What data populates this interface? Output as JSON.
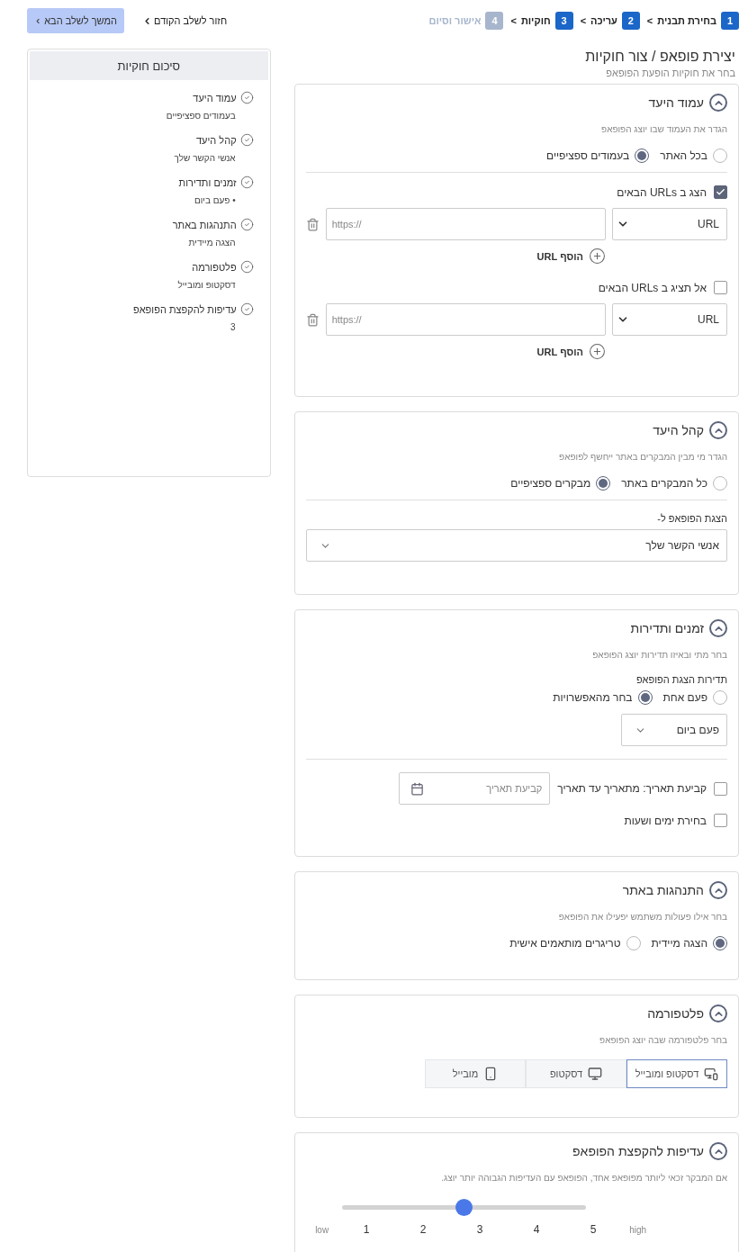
{
  "steps": [
    {
      "number": "1",
      "label": "בחירת תבנית",
      "separator": ">",
      "disabled": false
    },
    {
      "number": "2",
      "label": "עריכה",
      "separator": ">",
      "disabled": false
    },
    {
      "number": "3",
      "label": "חוקיות",
      "separator": ">",
      "disabled": false
    },
    {
      "number": "4",
      "label": "אישור וסיום",
      "disabled": true
    }
  ],
  "back_button": {
    "label": "חזור לשלב הקודם"
  },
  "next_button": {
    "label": "המשך לשלב הבא"
  },
  "page_title": "יצירת פופאפ / צור חוקיות",
  "page_subtitle": "בחר את חוקיות הופעת הפופאפ",
  "summary": {
    "title": "סיכום חוקיות",
    "items": [
      {
        "title": "עמוד היעד",
        "value": "בעמודים ספציפיים"
      },
      {
        "title": "קהל היעד",
        "value": "אנשי הקשר שלך"
      },
      {
        "title": "זמנים ותדירות",
        "value": "• פעם ביום"
      },
      {
        "title": "התנהגות באתר",
        "value": "הצגה מיידית"
      },
      {
        "title": "פלטפורמה",
        "value": "דסקטופ ומובייל"
      },
      {
        "title": "עדיפות להקפצת הפופאפ",
        "value": "3"
      }
    ]
  },
  "sections": [
    {
      "title": "עמוד היעד",
      "description": "הגדר את העמוד שבו יוצג הפופאפ",
      "expanded": true,
      "blocks": [
        {
          "kind": "radio",
          "options": [
            {
              "label": "בכל האתר",
              "selected": false
            },
            {
              "label": "בעמודים ספציפיים",
              "selected": true
            }
          ]
        },
        {
          "kind": "divider"
        },
        {
          "kind": "url_group",
          "label": "הצג ב URLs הבאים",
          "checked": true,
          "rows": [
            {
              "type": "URL",
              "placeholder": "https://"
            }
          ],
          "add_label": "הוסף URL"
        },
        {
          "kind": "url_group",
          "label": "אל תציג ב URLs הבאים",
          "checked": false,
          "rows": [
            {
              "type": "URL",
              "placeholder": "https://"
            }
          ],
          "add_label": "הוסף URL"
        }
      ]
    },
    {
      "title": "קהל היעד",
      "description": "הגדר מי מבין המבקרים באתר ייחשף לפופאפ",
      "expanded": true,
      "blocks": [
        {
          "kind": "radio",
          "options": [
            {
              "label": "כל המבקרים באתר",
              "selected": false
            },
            {
              "label": "מבקרים ספציפיים",
              "selected": true
            }
          ]
        },
        {
          "kind": "divider"
        },
        {
          "kind": "select",
          "label": "הצגת הפופאפ ל-",
          "value": "אנשי הקשר שלך"
        }
      ]
    },
    {
      "title": "זמנים ותדירות",
      "description": "בחר מתי ובאיזו תדירות יוצג הפופאפ",
      "expanded": true,
      "blocks": [
        {
          "kind": "label",
          "text": "תדירות הצגת הפופאפ"
        },
        {
          "kind": "radio",
          "options": [
            {
              "label": "פעם אחת",
              "selected": false
            },
            {
              "label": "בחר מהאפשרויות",
              "selected": true
            }
          ]
        },
        {
          "kind": "small_select",
          "value": "פעם ביום"
        },
        {
          "kind": "divider"
        },
        {
          "kind": "date_check",
          "label": "קביעת תאריך: מתאריך עד תאריך",
          "checked": false,
          "placeholder": "קביעת תאריך"
        },
        {
          "kind": "check",
          "label": "בחירת ימים ושעות",
          "checked": false
        }
      ]
    },
    {
      "title": "התנהגות באתר",
      "description": "בחר אילו פעולות משתמש יפעילו את הפופאפ",
      "expanded": true,
      "blocks": [
        {
          "kind": "radio",
          "options": [
            {
              "label": "הצגה מיידית",
              "selected": true
            },
            {
              "label": "טריגרים מותאמים אישית",
              "selected": false
            }
          ]
        }
      ]
    },
    {
      "title": "פלטפורמה",
      "description": "בחר פלטפורמה שבה יוצג הפופאפ",
      "expanded": true,
      "blocks": [
        {
          "kind": "platforms",
          "options": [
            {
              "kind": "both",
              "label": "דסקטופ ומובייל",
              "selected": true
            },
            {
              "kind": "desktop",
              "label": "דסקטופ",
              "selected": false
            },
            {
              "kind": "mobile",
              "label": "מובייל",
              "selected": false
            }
          ]
        }
      ]
    },
    {
      "title": "עדיפות להקפצת הפופאפ",
      "description": "אם המבקר זכאי ליותר מפופאפ אחד, הפופאפ עם העדיפות הגבוהה יותר יוצג.",
      "expanded": true,
      "blocks": [
        {
          "kind": "slider",
          "level": 0.5,
          "high": "high",
          "ticks": [
            "5",
            "4",
            "3",
            "2",
            "1"
          ],
          "low": "low"
        }
      ]
    }
  ]
}
